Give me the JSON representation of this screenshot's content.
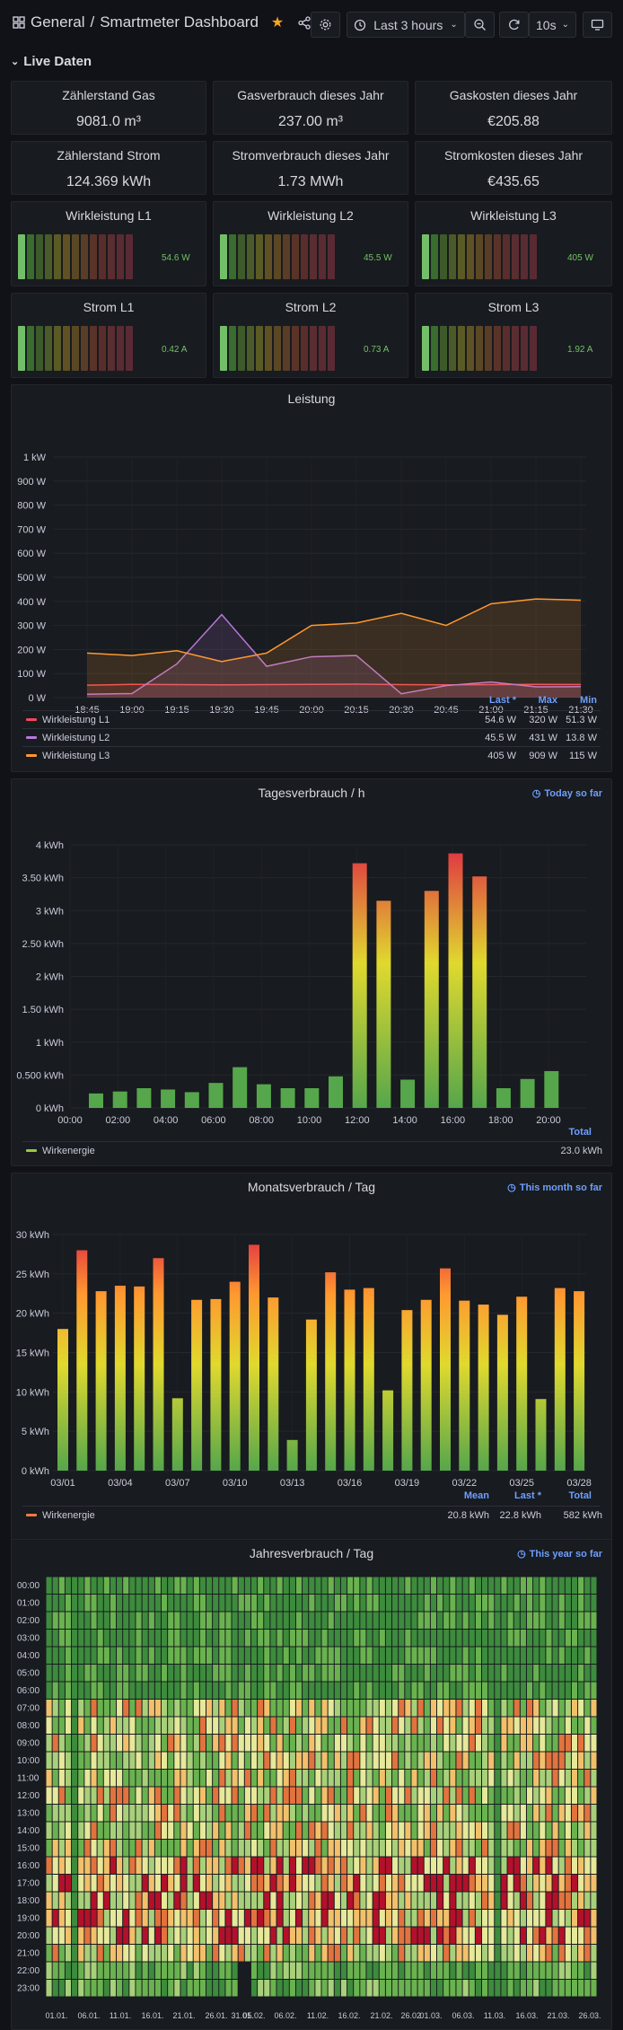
{
  "header": {
    "folder": "General",
    "separator": "/",
    "title": "Smartmeter Dashboard",
    "time_range": "Last 3 hours",
    "refresh_interval": "10s"
  },
  "row": {
    "title": "Live Daten"
  },
  "stats": [
    {
      "title": "Zählerstand Gas",
      "value": "9081.0 m³"
    },
    {
      "title": "Gasverbrauch dieses Jahr",
      "value": "237.00 m³"
    },
    {
      "title": "Gaskosten dieses Jahr",
      "value": "€205.88"
    },
    {
      "title": "Zählerstand Strom",
      "value": "124.369 kWh"
    },
    {
      "title": "Stromverbrauch dieses Jahr",
      "value": "1.73 MWh"
    },
    {
      "title": "Stromkosten dieses Jahr",
      "value": "€435.65"
    }
  ],
  "gauges": [
    {
      "title": "Wirkleistung L1",
      "value": "54.6 W",
      "fill": 0.07
    },
    {
      "title": "Wirkleistung L2",
      "value": "45.5 W",
      "fill": 0.07
    },
    {
      "title": "Wirkleistung L3",
      "value": "405 W",
      "fill": 0.07
    },
    {
      "title": "Strom L1",
      "value": "0.42 A",
      "fill": 0.07
    },
    {
      "title": "Strom L2",
      "value": "0.73 A",
      "fill": 0.07
    },
    {
      "title": "Strom L3",
      "value": "1.92 A",
      "fill": 0.07
    }
  ],
  "leistung": {
    "title": "Leistung",
    "legend_headers": [
      "Last *",
      "Max",
      "Min"
    ],
    "legend": [
      {
        "name": "Wirkleistung L1",
        "color": "#f2495c",
        "last": "54.6 W",
        "max": "320 W",
        "min": "51.3 W"
      },
      {
        "name": "Wirkleistung L2",
        "color": "#b877d9",
        "last": "45.5 W",
        "max": "431 W",
        "min": "13.8 W"
      },
      {
        "name": "Wirkleistung L3",
        "color": "#ff9830",
        "last": "405 W",
        "max": "909 W",
        "min": "115 W"
      }
    ]
  },
  "tages": {
    "title": "Tagesverbrauch / h",
    "time_shift": "Today so far",
    "legend_header": "Total",
    "legend_name": "Wirkenergie",
    "legend_color": "#9ac942",
    "legend_total": "23.0 kWh"
  },
  "monats": {
    "title": "Monatsverbrauch / Tag",
    "time_shift": "This month so far",
    "legend_headers": [
      "Mean",
      "Last *",
      "Total"
    ],
    "legend_name": "Wirkenergie",
    "legend_color": "#ff7a45",
    "legend_values": [
      "20.8 kWh",
      "22.8 kWh",
      "582 kWh"
    ]
  },
  "jahres": {
    "title": "Jahresverbrauch / Tag",
    "time_shift": "This year so far",
    "hours": [
      "00:00",
      "01:00",
      "02:00",
      "03:00",
      "04:00",
      "05:00",
      "06:00",
      "07:00",
      "08:00",
      "09:00",
      "10:00",
      "11:00",
      "12:00",
      "13:00",
      "14:00",
      "15:00",
      "16:00",
      "17:00",
      "18:00",
      "19:00",
      "20:00",
      "21:00",
      "22:00",
      "23:00"
    ],
    "date_labels": [
      "01.01.",
      "06.01.",
      "11.01.",
      "16.01.",
      "21.01.",
      "26.01.",
      "31.01.",
      "05.02.",
      "06.02.",
      "11.02.",
      "16.02.",
      "21.02.",
      "26.02.",
      "01.03.",
      "06.03.",
      "11.03.",
      "16.03.",
      "21.03.",
      "26.03."
    ]
  },
  "chart_data": [
    {
      "type": "line",
      "title": "Leistung",
      "x": [
        "18:45",
        "19:00",
        "19:15",
        "19:30",
        "19:45",
        "20:00",
        "20:15",
        "20:30",
        "20:45",
        "21:00",
        "21:15",
        "21:30"
      ],
      "ylim": [
        0,
        1000
      ],
      "yticks": [
        "0 W",
        "100 W",
        "200 W",
        "300 W",
        "400 W",
        "500 W",
        "600 W",
        "700 W",
        "800 W",
        "900 W",
        "1 kW"
      ],
      "series": [
        {
          "name": "Wirkleistung L1",
          "color": "#f2495c",
          "values": [
            52,
            55,
            54,
            53,
            54,
            55,
            56,
            54,
            53,
            54,
            55,
            54.6
          ]
        },
        {
          "name": "Wirkleistung L2",
          "color": "#b877d9",
          "values": [
            14,
            17,
            140,
            345,
            130,
            170,
            175,
            16,
            50,
            65,
            45,
            45.5
          ]
        },
        {
          "name": "Wirkleistung L3",
          "color": "#ff9830",
          "values": [
            185,
            175,
            195,
            150,
            185,
            300,
            310,
            350,
            300,
            390,
            410,
            405
          ]
        }
      ]
    },
    {
      "type": "bar",
      "title": "Tagesverbrauch / h",
      "x_ticks": [
        "00:00",
        "02:00",
        "04:00",
        "06:00",
        "08:00",
        "10:00",
        "12:00",
        "14:00",
        "16:00",
        "18:00",
        "20:00"
      ],
      "y_ticks": [
        "0 kWh",
        "0.500 kWh",
        "1 kWh",
        "1.50 kWh",
        "2 kWh",
        "2.50 kWh",
        "3 kWh",
        "3.50 kWh",
        "4 kWh"
      ],
      "ylim": [
        0,
        4
      ],
      "values": [
        0.22,
        0.25,
        0.3,
        0.28,
        0.24,
        0.38,
        0.62,
        0.36,
        0.3,
        0.3,
        0.48,
        3.72,
        3.15,
        0.43,
        3.3,
        3.87,
        3.52,
        0.3,
        0.44,
        0.56
      ]
    },
    {
      "type": "bar",
      "title": "Monatsverbrauch / Tag",
      "x_ticks": [
        "03/01",
        "03/04",
        "03/07",
        "03/10",
        "03/13",
        "03/16",
        "03/19",
        "03/22",
        "03/25",
        "03/28"
      ],
      "y_ticks": [
        "0 kWh",
        "5 kWh",
        "10 kWh",
        "15 kWh",
        "20 kWh",
        "25 kWh",
        "30 kWh"
      ],
      "ylim": [
        0,
        30
      ],
      "values": [
        18,
        28,
        22.8,
        23.5,
        23.4,
        27,
        9.2,
        21.7,
        21.8,
        24,
        28.7,
        22,
        3.9,
        19.2,
        25.2,
        23,
        23.2,
        10.2,
        20.4,
        21.7,
        25.7,
        21.6,
        21.1,
        19.8,
        22.1,
        9.1,
        23.2,
        22.8
      ]
    },
    {
      "type": "heatmap",
      "title": "Jahresverbrauch / Tag",
      "rows": 24,
      "days": 86,
      "note": "hourly consumption per day (qualitative, low=green, high=red)"
    }
  ]
}
